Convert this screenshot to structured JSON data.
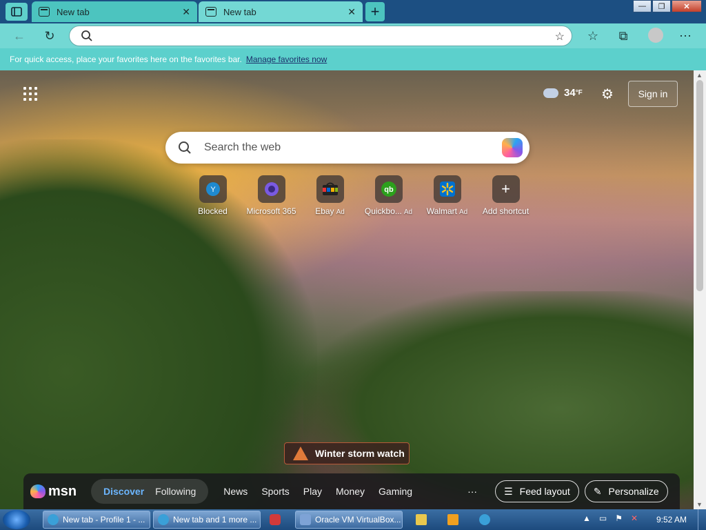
{
  "browser": {
    "tabs": [
      {
        "title": "New tab",
        "active": false
      },
      {
        "title": "New tab",
        "active": true
      }
    ],
    "new_tab_symbol": "+",
    "window_controls": {
      "minimize": "—",
      "restore": "❐",
      "close": "✕"
    },
    "address_bar": {
      "value": "",
      "placeholder": ""
    },
    "favorites_bar": {
      "message": "For quick access, place your favorites here on the favorites bar.",
      "link": "Manage favorites now"
    }
  },
  "newtab": {
    "weather": {
      "temp": "34",
      "unit": "°F"
    },
    "sign_in": "Sign in",
    "search_placeholder": "Search the web",
    "shortcuts": [
      {
        "label": "Blocked",
        "ad": "",
        "icon": "Y",
        "color": "#1f8ad0"
      },
      {
        "label": "Microsoft 365",
        "ad": "",
        "icon": "365-icon",
        "color": "#7a5ae0"
      },
      {
        "label": "Ebay",
        "ad": "Ad",
        "icon": "ebay-icon",
        "color": "#e53238"
      },
      {
        "label": "Quickbo...",
        "ad": "Ad",
        "icon": "qb",
        "color": "#2ca01c"
      },
      {
        "label": "Walmart",
        "ad": "Ad",
        "icon": "walmart-icon",
        "color": "#0071ce"
      },
      {
        "label": "Add shortcut",
        "ad": "",
        "icon": "+",
        "color": ""
      }
    ],
    "alert": "Winter storm watch",
    "msn": {
      "logo": "msn",
      "tabs": [
        {
          "label": "Discover",
          "active": true
        },
        {
          "label": "Following",
          "active": false
        }
      ],
      "nav": [
        "News",
        "Sports",
        "Play",
        "Money",
        "Gaming"
      ],
      "more": "···",
      "feed_layout": "Feed layout",
      "personalize": "Personalize"
    }
  },
  "taskbar": {
    "buttons": [
      {
        "label": "New tab - Profile 1 - ..."
      },
      {
        "label": "New tab and 1 more ..."
      },
      {
        "label": "Oracle VM VirtualBox..."
      }
    ],
    "clock": "9:52 AM"
  }
}
